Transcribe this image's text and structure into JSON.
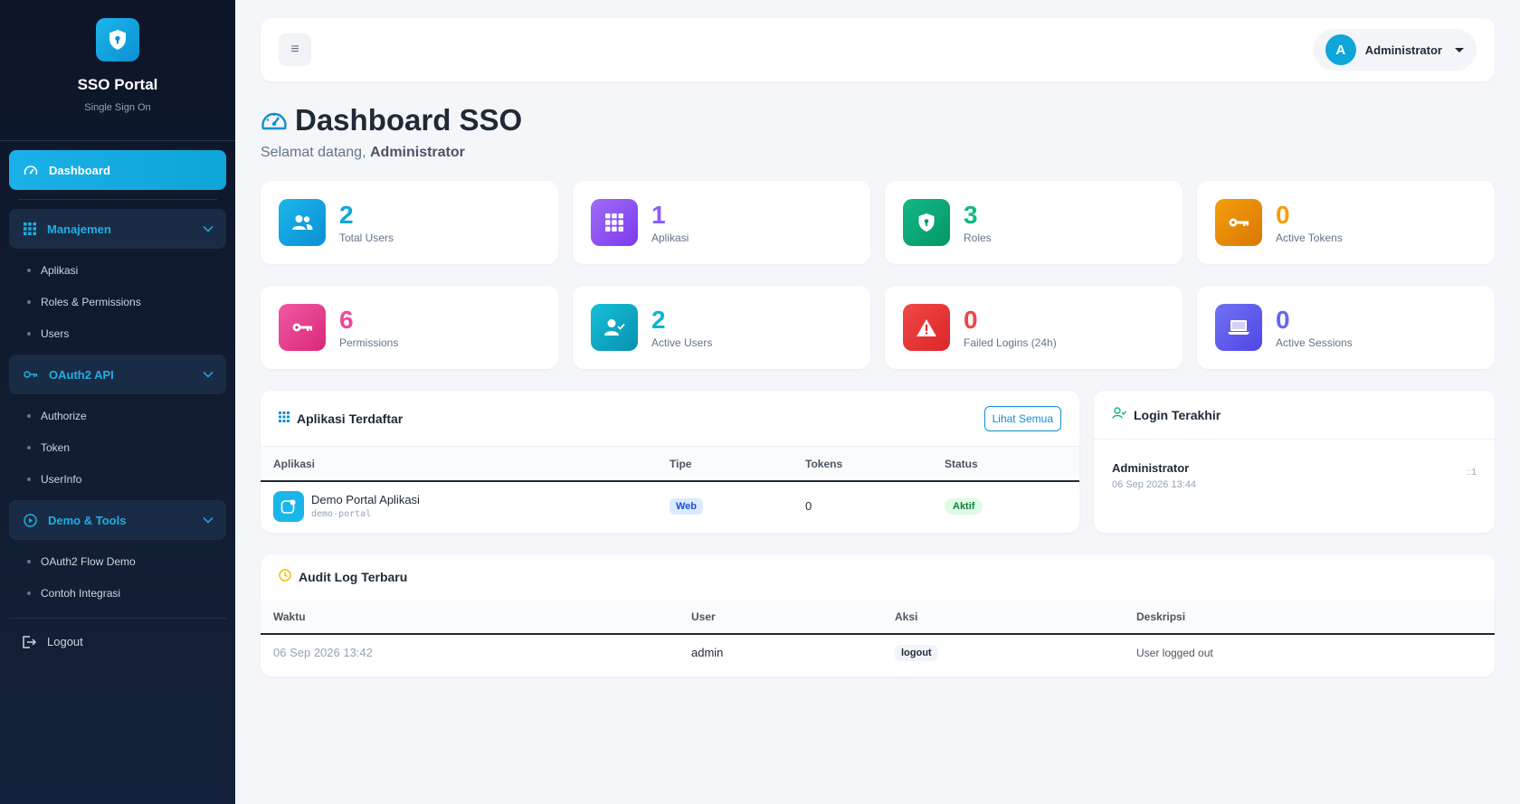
{
  "brand": {
    "title": "SSO Portal",
    "subtitle": "Single Sign On"
  },
  "sidebar": {
    "active": "Dashboard",
    "groups": [
      {
        "label": "Manajemen",
        "items": [
          "Aplikasi",
          "Roles & Permissions",
          "Users"
        ]
      },
      {
        "label": "OAuth2 API",
        "items": [
          "Authorize",
          "Token",
          "UserInfo"
        ]
      },
      {
        "label": "Demo & Tools",
        "items": [
          "OAuth2 Flow Demo",
          "Contoh Integrasi"
        ]
      }
    ],
    "logout": "Logout"
  },
  "topbar": {
    "menu_glyph": "≡",
    "avatar_initial": "A",
    "user_name": "Administrator"
  },
  "page": {
    "title": "Dashboard SSO",
    "welcome_prefix": "Selamat datang,",
    "welcome_name": "Administrator"
  },
  "stats": [
    {
      "value": "2",
      "label": "Total Users",
      "color": "#0ea5d8",
      "icon": "users-icon"
    },
    {
      "value": "1",
      "label": "Aplikasi",
      "color": "#8b5cf6",
      "icon": "grid-icon"
    },
    {
      "value": "3",
      "label": "Roles",
      "color": "#10b981",
      "icon": "shield-icon"
    },
    {
      "value": "0",
      "label": "Active Tokens",
      "color": "#f59e0b",
      "icon": "key-icon"
    },
    {
      "value": "6",
      "label": "Permissions",
      "color": "#ec4899",
      "icon": "key-icon"
    },
    {
      "value": "2",
      "label": "Active Users",
      "color": "#06b6d4",
      "icon": "user-check-icon"
    },
    {
      "value": "0",
      "label": "Failed Logins (24h)",
      "color": "#ef4444",
      "icon": "warning-icon"
    },
    {
      "value": "0",
      "label": "Active Sessions",
      "color": "#6366f1",
      "icon": "laptop-icon"
    }
  ],
  "apps": {
    "title": "Aplikasi Terdaftar",
    "view_all": "Lihat Semua",
    "columns": [
      "Aplikasi",
      "Tipe",
      "Tokens",
      "Status"
    ],
    "rows": [
      {
        "name": "Demo Portal Aplikasi",
        "code": "demo-portal",
        "type": "Web",
        "tokens": "0",
        "status": "Aktif"
      }
    ]
  },
  "login": {
    "title": "Login Terakhir",
    "entries": [
      {
        "name": "Administrator",
        "time": "06 Sep 2026 13:44",
        "ip": "::1"
      }
    ]
  },
  "audit": {
    "title": "Audit Log Terbaru",
    "columns": [
      "Waktu",
      "User",
      "Aksi",
      "Deskripsi"
    ],
    "rows": [
      {
        "time": "06 Sep 2026 13:42",
        "user": "admin",
        "action": "logout",
        "description": "User logged out"
      }
    ]
  }
}
